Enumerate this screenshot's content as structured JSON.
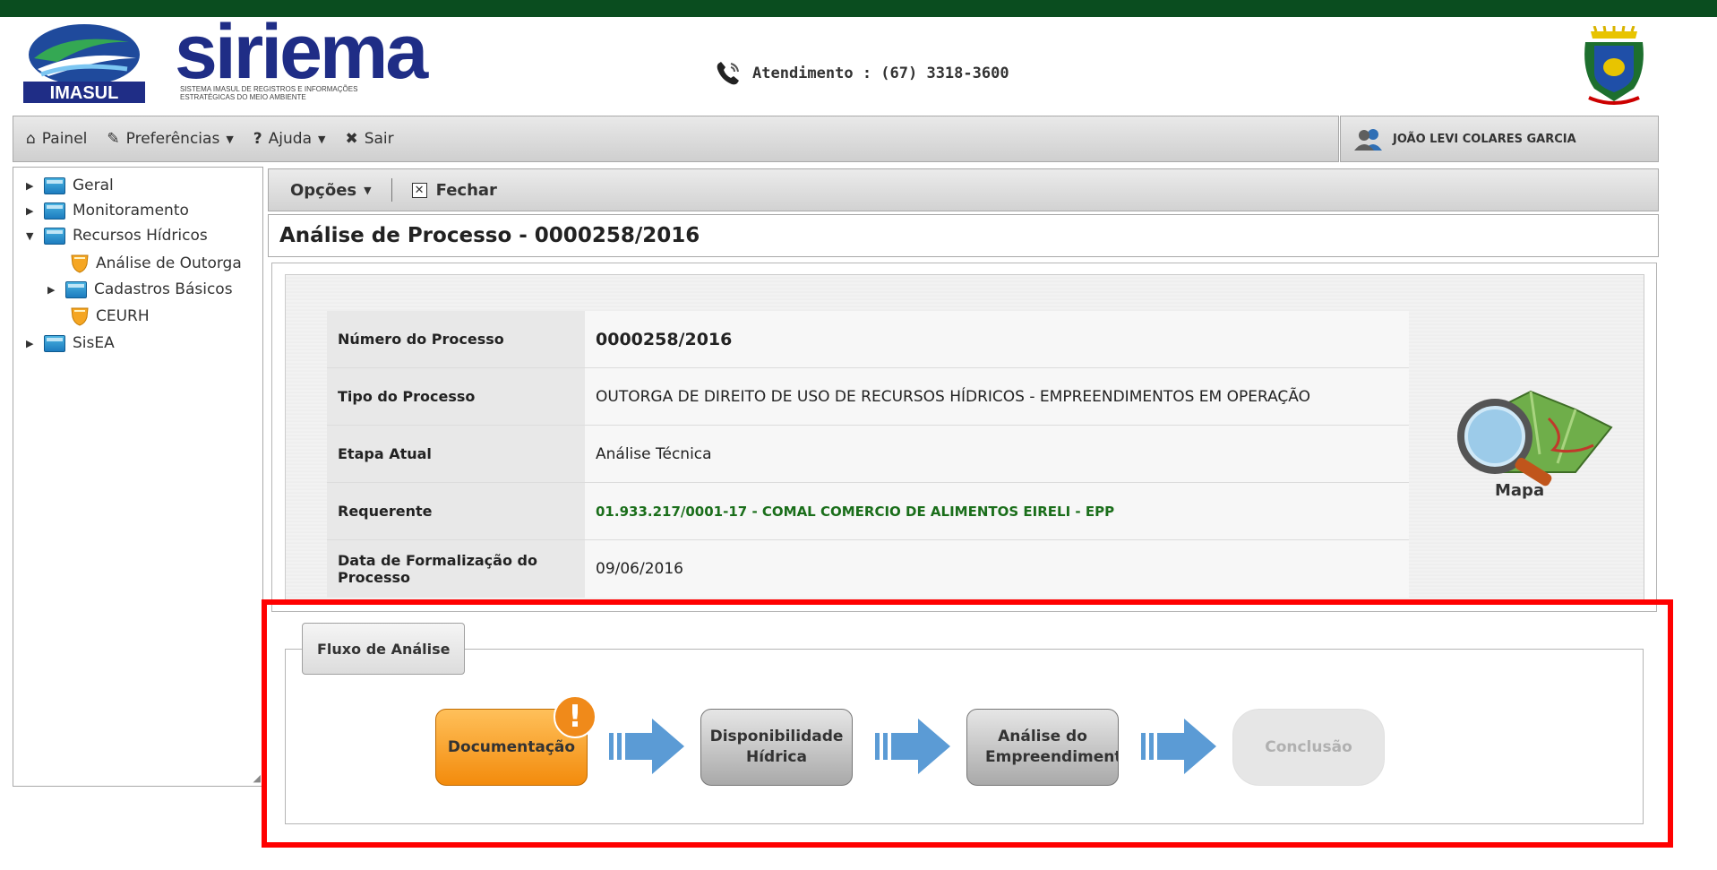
{
  "header": {
    "logo_imasul_text": "IMASUL",
    "logo_siriema_text": "siriema",
    "logo_siriema_subtitle": "SISTEMA IMASUL DE REGISTROS E INFORMAÇÕES ESTRATÉGICAS DO MEIO AMBIENTE",
    "phone_text": "Atendimento : (67) 3318-3600",
    "phone_icon": "phone-icon",
    "crest_icon": "state-crest-icon"
  },
  "menubar": {
    "painel": "Painel",
    "preferencias": "Preferências",
    "ajuda": "Ajuda",
    "sair": "Sair",
    "user_name": "JOÃO LEVI COLARES GARCIA"
  },
  "sidebar": {
    "items": [
      {
        "label": "Geral",
        "icon": "folder-icon"
      },
      {
        "label": "Monitoramento",
        "icon": "folder-icon"
      },
      {
        "label": "Recursos Hídricos",
        "icon": "folder-icon"
      },
      {
        "label": "Análise de Outorga",
        "icon": "shield-icon"
      },
      {
        "label": "Cadastros Básicos",
        "icon": "folder-icon"
      },
      {
        "label": "CEURH",
        "icon": "shield-icon"
      },
      {
        "label": "SisEA",
        "icon": "folder-icon"
      }
    ]
  },
  "toolbar": {
    "opcoes": "Opções",
    "fechar": "Fechar"
  },
  "page": {
    "title": "Análise de Processo - 0000258/2016"
  },
  "process": {
    "rows": [
      {
        "label": "Número do Processo",
        "value": "0000258/2016"
      },
      {
        "label": "Tipo do Processo",
        "value": "OUTORGA DE DIREITO DE USO DE RECURSOS HÍDRICOS - EMPREENDIMENTOS EM OPERAÇÃO"
      },
      {
        "label": "Etapa Atual",
        "value": "Análise Técnica"
      },
      {
        "label": "Requerente",
        "value": "01.933.217/0001-17 - COMAL COMERCIO DE ALIMENTOS EIRELI - EPP"
      },
      {
        "label": "Data de Formalização do Processo",
        "value": "09/06/2016"
      }
    ],
    "mapa_label": "Mapa"
  },
  "flow": {
    "legend": "Fluxo de Análise",
    "steps": [
      {
        "label_line1": "Documentação",
        "label_line2": "",
        "state": "current-alert"
      },
      {
        "label_line1": "Disponibilidade",
        "label_line2": "Hídrica",
        "state": "pending"
      },
      {
        "label_line1": "Análise do",
        "label_line2": "Empreendimento",
        "state": "pending"
      },
      {
        "label_line1": "Conclusão",
        "label_line2": "",
        "state": "disabled"
      }
    ],
    "alert_symbol": "!"
  },
  "colors": {
    "top_bar": "#0a4d1f",
    "step_current": "#f38b0c",
    "arrow": "#5b9bd5",
    "highlight": "#ff0000",
    "requerente_text": "#1a6e1a"
  }
}
